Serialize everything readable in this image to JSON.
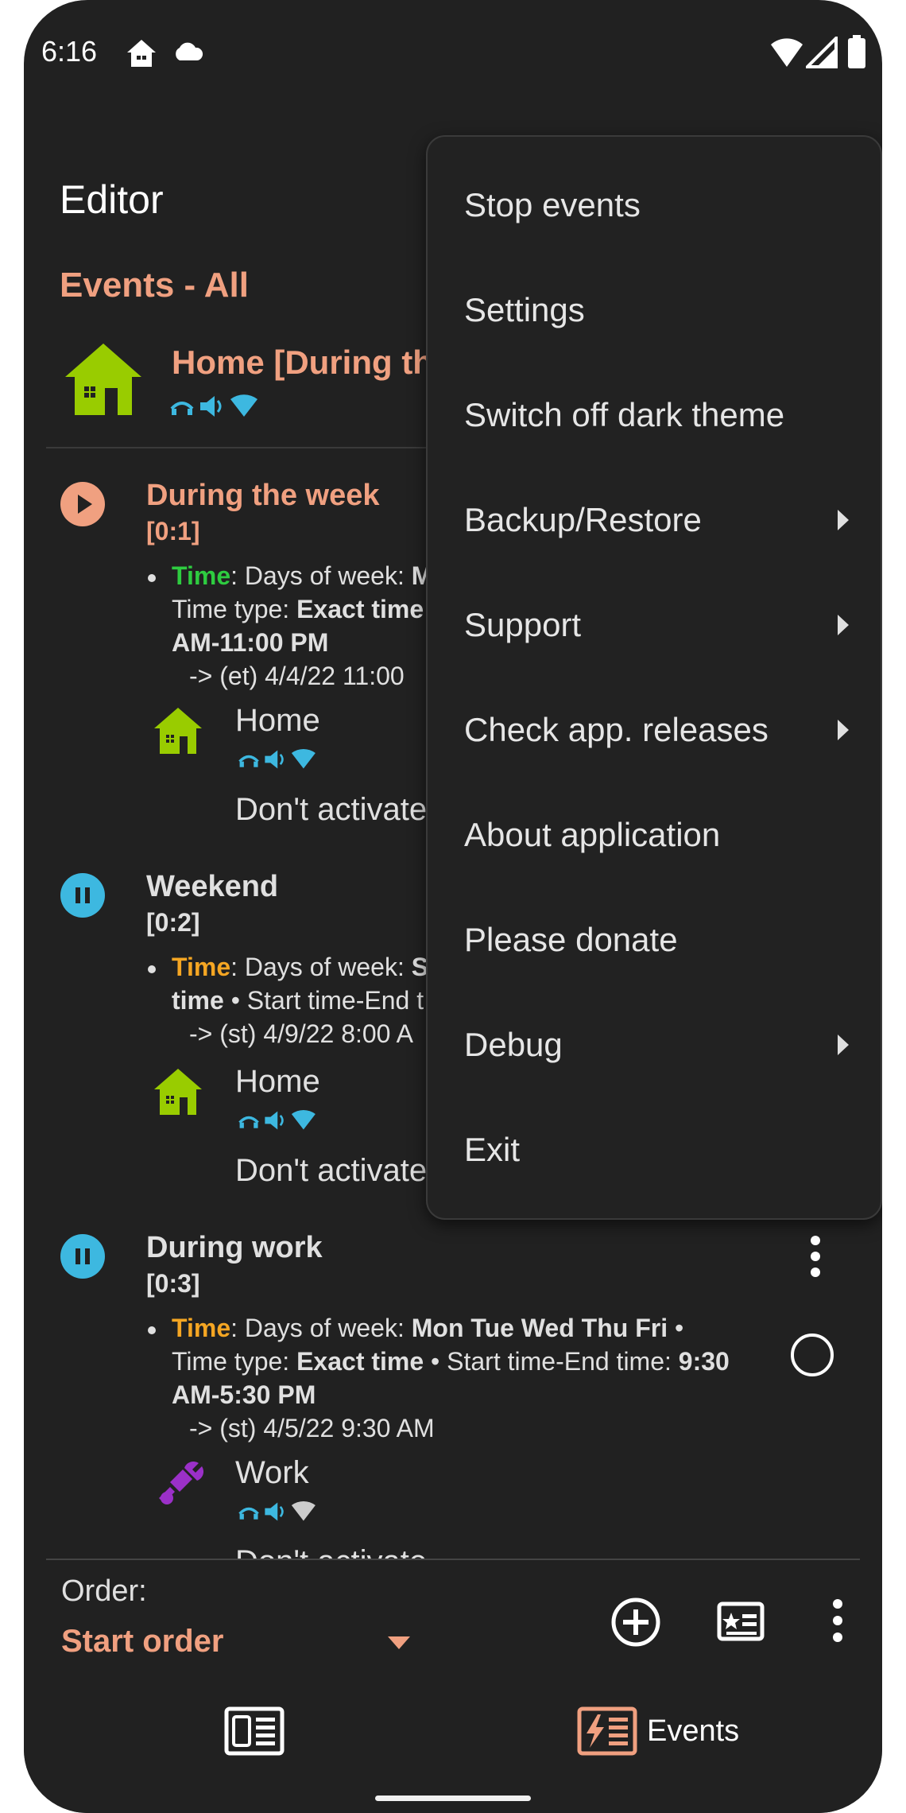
{
  "status_bar": {
    "time": "6:16"
  },
  "header": {
    "title": "Editor",
    "filter": "Events - All"
  },
  "active_profile": {
    "name": "Home [During th"
  },
  "events": [
    {
      "name": "During the week",
      "order": "[0:1]",
      "state": "running",
      "time_label": "Time",
      "time_color": "#2ecc40",
      "line1_prefix": ": Days of week: ",
      "line1_bold": "M",
      "line2_prefix": "Time type: ",
      "line2_bold": "Exact time",
      "line3_bold": "AM-11:00 PM",
      "next": "-> (et) 4/4/22 11:00",
      "profile": "Home",
      "action": "Don't activate"
    },
    {
      "name": "Weekend",
      "order": "[0:2]",
      "state": "paused",
      "time_label": "Time",
      "time_color": "#f5a623",
      "line1_prefix": ": Days of week: ",
      "line1_bold": "S",
      "line2_bold": "time",
      "line2_rest": " • Start time-End t",
      "next": "-> (st) 4/9/22 8:00 A",
      "profile": "Home",
      "action": "Don't activate"
    },
    {
      "name": "During work",
      "order": "[0:3]",
      "state": "paused",
      "time_label": "Time",
      "time_color": "#f5a623",
      "line1_prefix": ": Days of week: ",
      "line1_bold": "Mon Tue Wed Thu Fri",
      "line1_suffix": " •",
      "line2_prefix": "Time type: ",
      "line2_bold": "Exact time",
      "line2_mid": " • Start time-End time: ",
      "line2_bold2": "9:30",
      "line3_bold": "AM-5:30 PM",
      "next": "-> (st) 4/5/22 9:30 AM",
      "profile": "Work",
      "action": "Don't activate"
    }
  ],
  "menu": {
    "items": [
      {
        "label": "Stop events",
        "submenu": false
      },
      {
        "label": "Settings",
        "submenu": false
      },
      {
        "label": "Switch off dark theme",
        "submenu": false
      },
      {
        "label": "Backup/Restore",
        "submenu": true
      },
      {
        "label": "Support",
        "submenu": true
      },
      {
        "label": "Check app. releases",
        "submenu": true
      },
      {
        "label": "About application",
        "submenu": false
      },
      {
        "label": "Please donate",
        "submenu": false
      },
      {
        "label": "Debug",
        "submenu": true
      },
      {
        "label": "Exit",
        "submenu": false
      }
    ]
  },
  "bottom": {
    "order_label": "Order:",
    "order_value": "Start order",
    "nav_events": "Events"
  },
  "colors": {
    "accent_orange": "#f0a080",
    "play_icon": "#f0a080",
    "pause_icon": "#3db8e0",
    "home_green": "#99cc00",
    "work_purple": "#9b30c8",
    "icon_blue": "#3db8e0"
  },
  "icons": [
    "home-icon",
    "cloud-icon",
    "wifi-icon",
    "signal-icon",
    "battery-icon",
    "play-icon",
    "pause-icon",
    "add-icon",
    "profile-card-icon",
    "more-vert-icon",
    "dropdown-icon",
    "editor-nav-icon",
    "events-nav-icon",
    "work-icon",
    "radio-icon",
    "chevron-right-icon"
  ]
}
